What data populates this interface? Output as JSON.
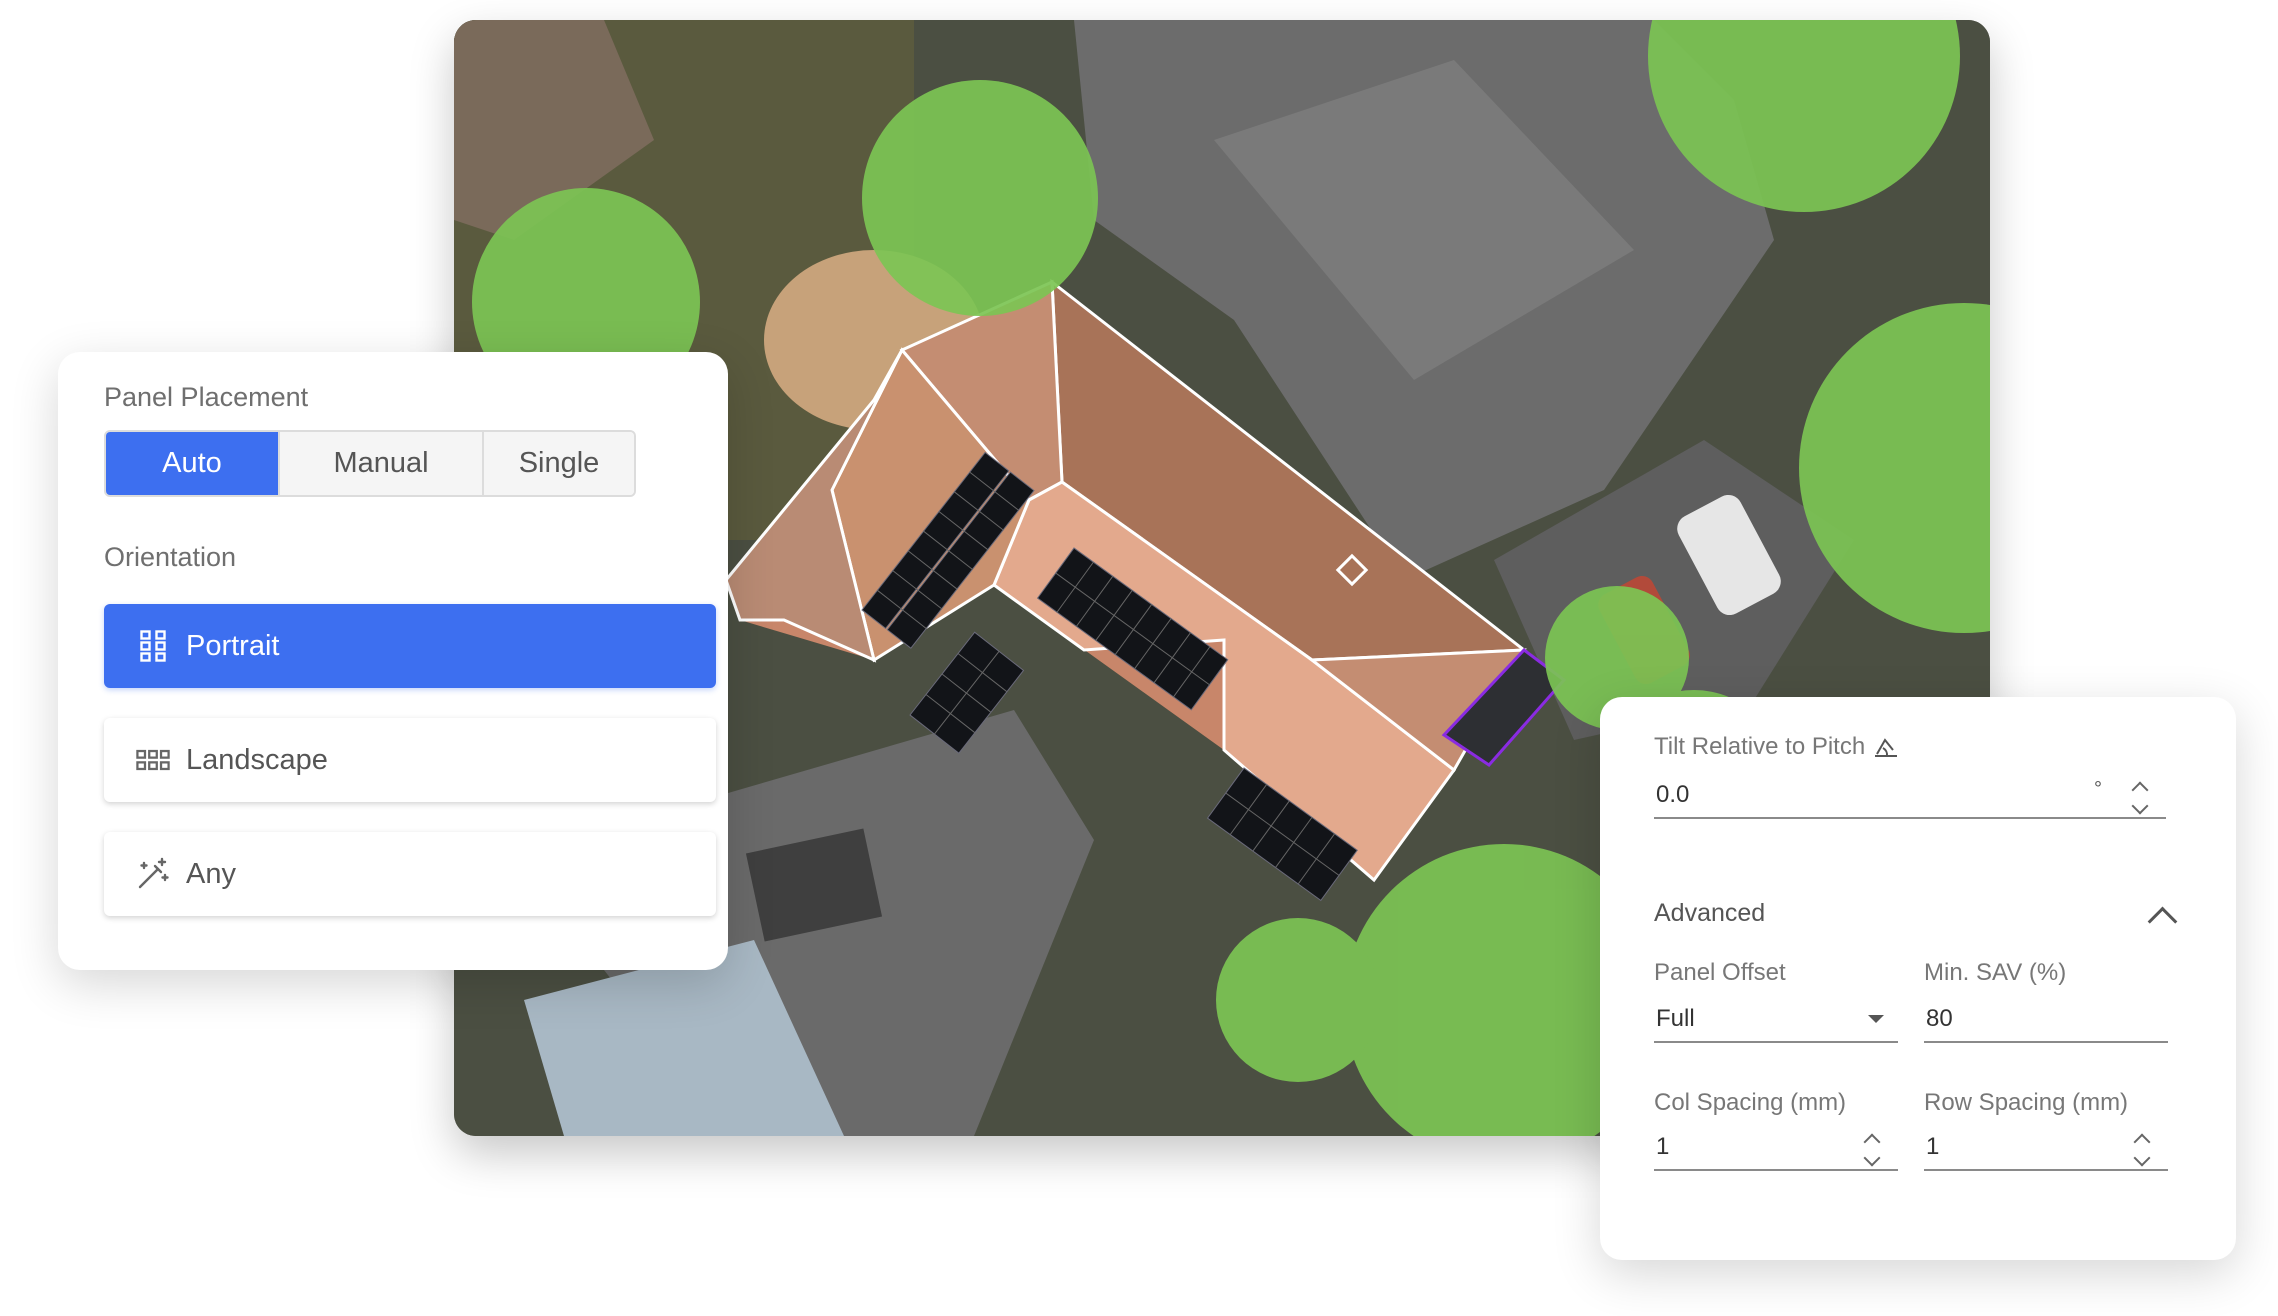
{
  "panel_placement": {
    "title": "Panel Placement",
    "modes": [
      {
        "label": "Auto",
        "active": true
      },
      {
        "label": "Manual",
        "active": false
      },
      {
        "label": "Single",
        "active": false
      }
    ]
  },
  "orientation": {
    "title": "Orientation",
    "options": [
      {
        "label": "Portrait",
        "icon": "grid-portrait-icon",
        "active": true
      },
      {
        "label": "Landscape",
        "icon": "grid-landscape-icon",
        "active": false
      },
      {
        "label": "Any",
        "icon": "magic-wand-icon",
        "active": false
      }
    ]
  },
  "settings": {
    "tilt_label": "Tilt Relative to Pitch",
    "tilt_icon": "pitch-icon",
    "tilt_value": "0.0",
    "tilt_unit": "°",
    "advanced_label": "Advanced",
    "panel_offset_label": "Panel Offset",
    "panel_offset_value": "Full",
    "min_sav_label": "Min. SAV (%)",
    "min_sav_value": "80",
    "col_spacing_label": "Col Spacing (mm)",
    "col_spacing_value": "1",
    "row_spacing_label": "Row Spacing (mm)",
    "row_spacing_value": "1"
  },
  "colors": {
    "accent": "#3d6ff0",
    "tree_overlay": "#7cc454",
    "roof_outline": "#ffffff",
    "selected_segment": "#8a2be2"
  }
}
